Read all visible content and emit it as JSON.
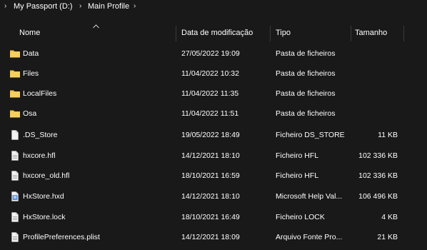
{
  "breadcrumb": {
    "items": [
      "My Passport (D:)",
      "Main Profile"
    ],
    "separator": "›"
  },
  "columns": {
    "name": "Nome",
    "date": "Data de modificação",
    "type": "Tipo",
    "size": "Tamanho"
  },
  "files": [
    {
      "name": "Data",
      "date": "27/05/2022 19:09",
      "type": "Pasta de ficheiros",
      "size": "",
      "icon": "folder-icon"
    },
    {
      "name": "Files",
      "date": "11/04/2022 10:32",
      "type": "Pasta de ficheiros",
      "size": "",
      "icon": "folder-icon"
    },
    {
      "name": "LocalFiles",
      "date": "11/04/2022 11:35",
      "type": "Pasta de ficheiros",
      "size": "",
      "icon": "folder-icon"
    },
    {
      "name": "Osa",
      "date": "11/04/2022 11:51",
      "type": "Pasta de ficheiros",
      "size": "",
      "icon": "folder-icon"
    },
    {
      "name": ".DS_Store",
      "date": "19/05/2022 18:49",
      "type": "Ficheiro DS_STORE",
      "size": "11 KB",
      "icon": "blank-file-icon"
    },
    {
      "name": "hxcore.hfl",
      "date": "14/12/2021 18:10",
      "type": "Ficheiro HFL",
      "size": "102 336 KB",
      "icon": "document-file-icon"
    },
    {
      "name": "hxcore_old.hfl",
      "date": "18/10/2021 16:59",
      "type": "Ficheiro HFL",
      "size": "102 336 KB",
      "icon": "document-file-icon"
    },
    {
      "name": "HxStore.hxd",
      "date": "14/12/2021 18:10",
      "type": "Microsoft Help Val...",
      "size": "106 496 KB",
      "icon": "help-file-icon"
    },
    {
      "name": "HxStore.lock",
      "date": "18/10/2021 16:49",
      "type": "Ficheiro LOCK",
      "size": "4 KB",
      "icon": "document-file-icon"
    },
    {
      "name": "ProfilePreferences.plist",
      "date": "14/12/2021 18:09",
      "type": "Arquivo Fonte Pro...",
      "size": "21 KB",
      "icon": "document-file-icon"
    }
  ],
  "colors": {
    "background": "#191919",
    "folder": "#f3c44c",
    "text": "#ffffff",
    "divider": "#3a3a3a"
  }
}
